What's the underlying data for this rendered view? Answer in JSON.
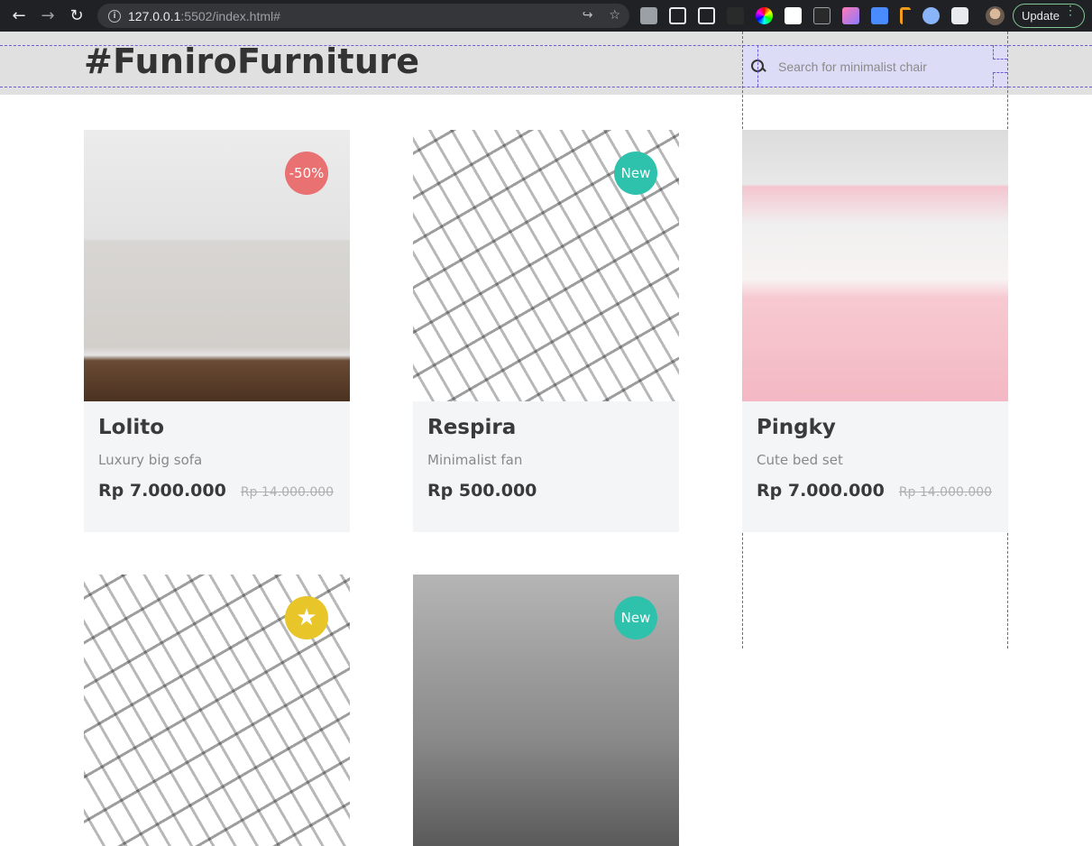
{
  "browser": {
    "url_host": "127.0.0.1",
    "url_path": ":5502/index.html#",
    "update_label": "Update",
    "extensions": [
      "#9aa0a6",
      "#e8eaed",
      "#e8eaed",
      "#e8eaed",
      "#333",
      "#e07bff",
      "#ffffff",
      "#9aa0a6",
      "#ff7ab6",
      "#4a8cff",
      "#f59c1a",
      "#8ab4f8",
      "#e8eaed"
    ]
  },
  "header": {
    "brand": "#FuniroFurniture",
    "search_placeholder": "Search for minimalist chair"
  },
  "products": [
    {
      "name": "Lolito",
      "description": "Luxury big sofa",
      "price": "Rp 7.000.000",
      "old_price": "Rp 14.000.000",
      "badge": "-50%",
      "badge_color": "#e97171",
      "image": "sofa"
    },
    {
      "name": "Respira",
      "description": "Minimalist fan",
      "price": "Rp 500.000",
      "old_price": "",
      "badge": "New",
      "badge_color": "#2ec1ac",
      "image": "ceiling-fan"
    },
    {
      "name": "Pingky",
      "description": "Cute bed set",
      "price": "Rp 7.000.000",
      "old_price": "Rp 14.000.000",
      "badge": "",
      "badge_color": "",
      "image": "pink-bed-set"
    },
    {
      "name": "",
      "description": "",
      "price": "",
      "old_price": "",
      "badge": "★",
      "badge_color": "#e8c62a",
      "image": "ceiling-fan"
    },
    {
      "name": "",
      "description": "",
      "price": "",
      "old_price": "",
      "badge": "New",
      "badge_color": "#2ec1ac",
      "image": "dark-sofa"
    }
  ]
}
